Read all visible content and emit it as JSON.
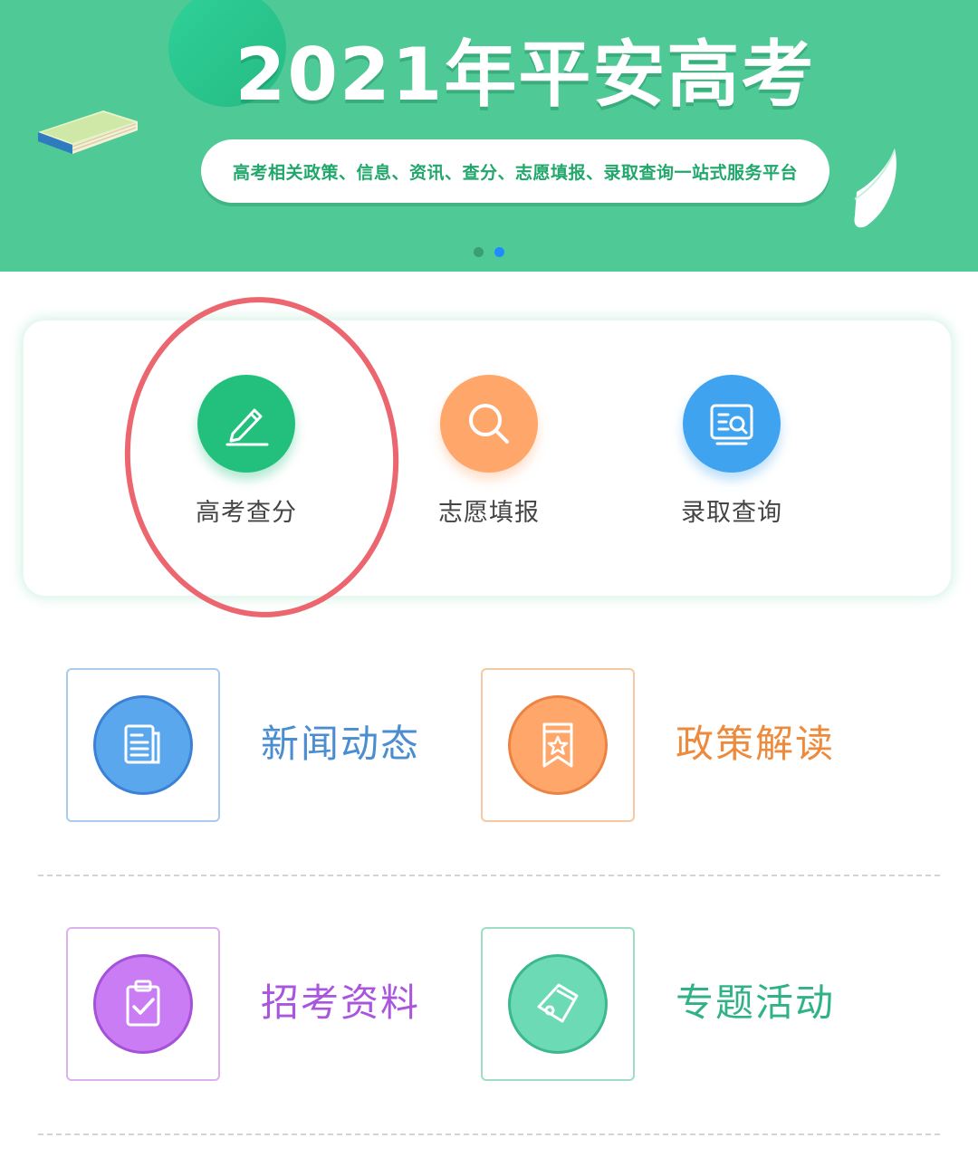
{
  "banner": {
    "title": "2021年平安高考",
    "subtitle": "高考相关政策、信息、资讯、查分、志愿填报、录取查询一站式服务平台",
    "carousel": {
      "total": 2,
      "active_index": 2
    },
    "background_color": "#4fc995"
  },
  "services": [
    {
      "label": "高考查分",
      "icon": "pencil-icon",
      "color": "#23c07d",
      "highlighted": true
    },
    {
      "label": "志愿填报",
      "icon": "search-icon",
      "color": "#ffa66b"
    },
    {
      "label": "录取查询",
      "icon": "document-search-icon",
      "color": "#3fa3f0"
    }
  ],
  "highlight_color": "#ec6670",
  "categories": [
    {
      "label": "新闻动态",
      "icon": "newspaper-icon",
      "color": "#4a8ed1"
    },
    {
      "label": "政策解读",
      "icon": "bookmark-star-icon",
      "color": "#ee8a3c"
    },
    {
      "label": "招考资料",
      "icon": "clipboard-check-icon",
      "color": "#aa55de"
    },
    {
      "label": "专题活动",
      "icon": "tag-icon",
      "color": "#30b287"
    }
  ]
}
